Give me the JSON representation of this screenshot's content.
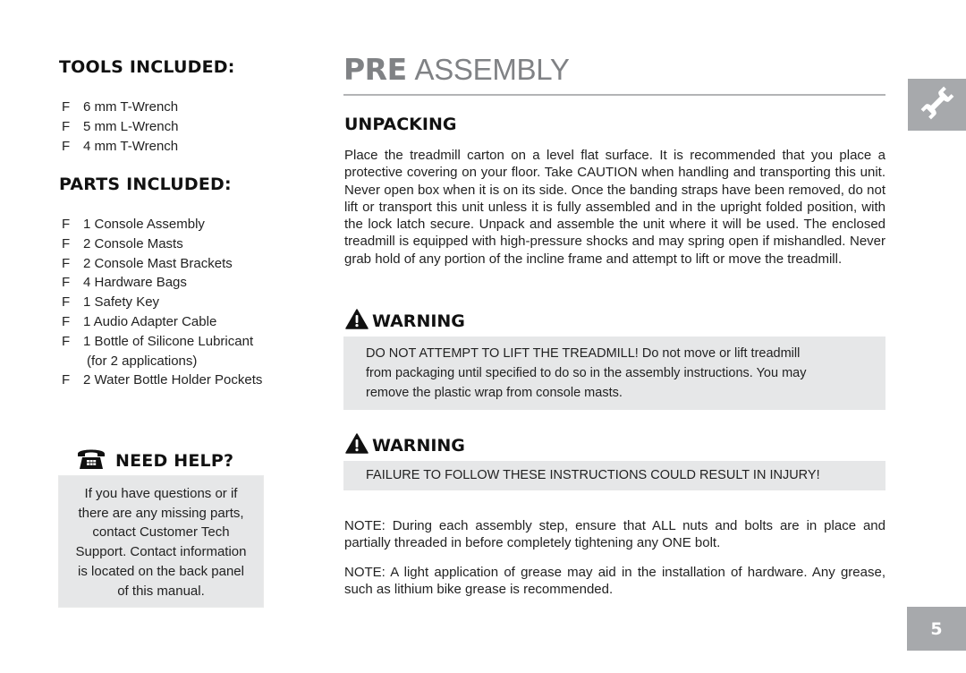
{
  "tools": {
    "heading": "TOOLS INCLUDED:",
    "bullet": "F",
    "items": [
      "6 mm T-Wrench",
      "5 mm L-Wrench",
      "4 mm T-Wrench"
    ]
  },
  "parts": {
    "heading": "PARTS INCLUDED:",
    "bullet": "F",
    "items": [
      "1 Console Assembly",
      "2 Console Masts",
      "2 Console Mast Brackets",
      "4 Hardware Bags",
      "1 Safety Key",
      "1 Audio Adapter Cable",
      "1 Bottle of Silicone Lubricant",
      "2 Water Bottle Holder Pockets"
    ],
    "item_6_note": "(for 2 applications)"
  },
  "help": {
    "icon": "telephone-icon",
    "heading": "NEED HELP?",
    "lines": [
      "If you have questions or if",
      "there are any missing parts,",
      "contact Customer Tech",
      "Support. Contact information",
      "is located on the back panel",
      "of this manual."
    ]
  },
  "page": {
    "title_bold": "PRE",
    "title_light": "ASSEMBLY",
    "section_icon": "wrench-icon",
    "page_number": "5"
  },
  "unpacking": {
    "heading": "UNPACKING",
    "text": "Place the treadmill carton on a level flat surface. It is recommended that you place a protective covering on your floor. Take CAUTION when handling and transporting this unit. Never open box when it is on its side. Once the banding straps have been removed, do not lift or transport this unit unless it is fully assembled and in the upright folded position, with the lock latch secure. Unpack and assemble the unit where it will be used. The enclosed treadmill is equipped with high-pressure shocks and may spring open if mishandled. Never grab hold of any portion of the incline frame and attempt to lift or move the treadmill."
  },
  "warnings": [
    {
      "icon": "warning-triangle-icon",
      "heading": "WARNING",
      "lines": [
        "DO NOT ATTEMPT TO LIFT THE TREADMILL! Do not move or lift treadmill",
        "from packaging until specified to do so in the assembly instructions. You may",
        "remove the plastic wrap from console masts."
      ]
    },
    {
      "icon": "warning-triangle-icon",
      "heading": "WARNING",
      "lines": [
        "FAILURE TO FOLLOW THESE INSTRUCTIONS COULD RESULT IN INJURY!"
      ]
    }
  ],
  "notes": [
    "NOTE: During each assembly step, ensure that ALL nuts and bolts are in place and partially threaded in before completely tightening any ONE bolt.",
    "NOTE: A light application of grease may aid in the installation of hardware. Any grease, such as lithium bike grease is recommended."
  ],
  "colors": {
    "title_gray": "#808285",
    "box_gray": "#e6e7e8",
    "tab_gray": "#a7a9ac"
  }
}
